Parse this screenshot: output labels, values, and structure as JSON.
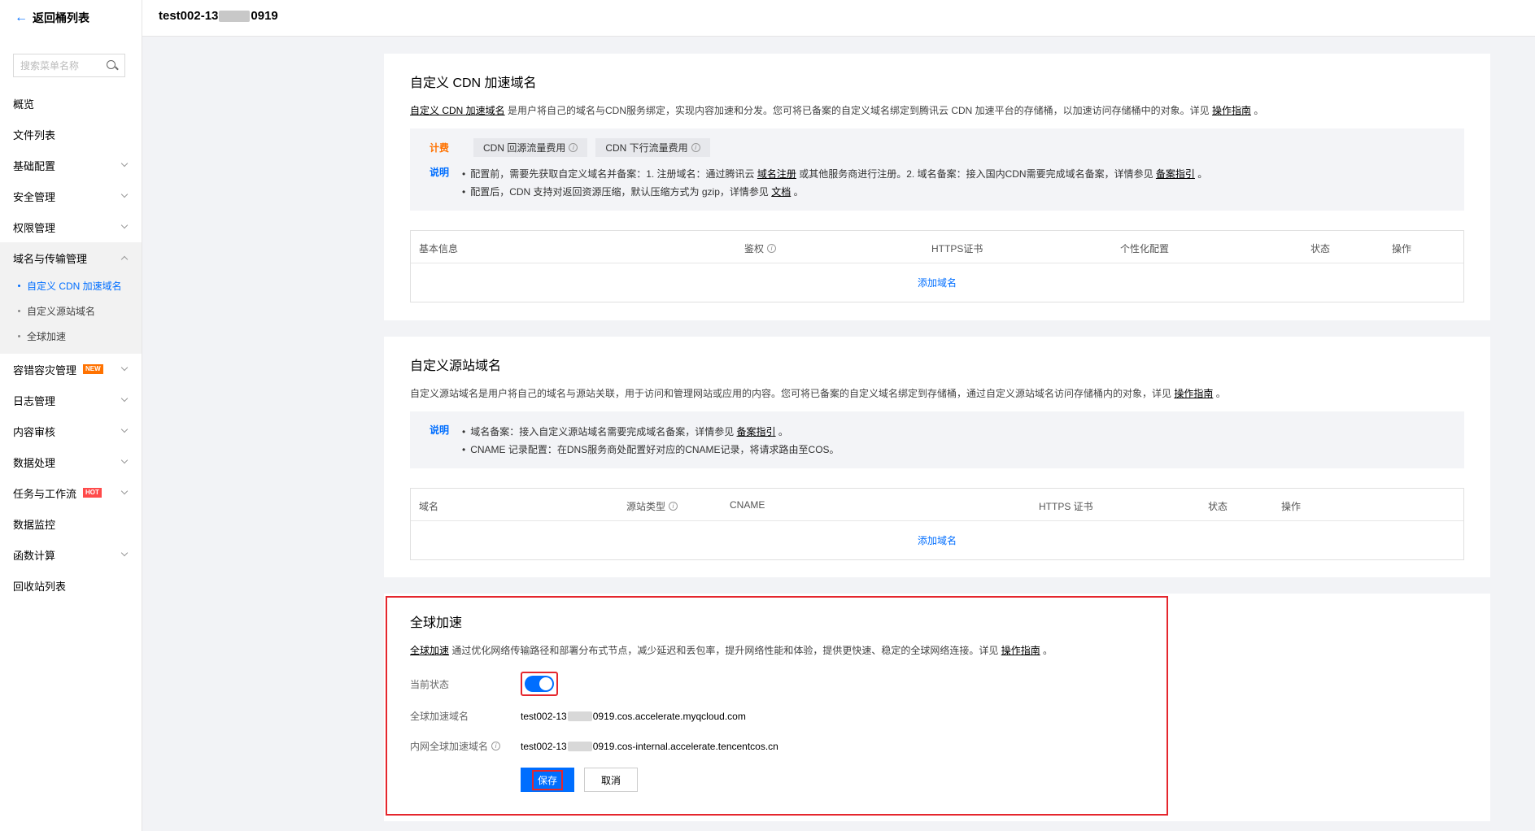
{
  "sidebar": {
    "back_label": "返回桶列表",
    "search_placeholder": "搜索菜单名称",
    "items": [
      {
        "label": "概览"
      },
      {
        "label": "文件列表"
      },
      {
        "label": "基础配置"
      },
      {
        "label": "安全管理"
      },
      {
        "label": "权限管理"
      },
      {
        "label": "域名与传输管理"
      },
      {
        "label": "容错容灾管理",
        "badge": "NEW"
      },
      {
        "label": "日志管理"
      },
      {
        "label": "内容审核"
      },
      {
        "label": "数据处理"
      },
      {
        "label": "任务与工作流",
        "badge": "HOT"
      },
      {
        "label": "数据监控"
      },
      {
        "label": "函数计算"
      },
      {
        "label": "回收站列表"
      }
    ],
    "sub_items": [
      "自定义 CDN 加速域名",
      "自定义源站域名",
      "全球加速"
    ]
  },
  "topbar": {
    "bucket_prefix": "test002-13",
    "bucket_suffix": "0919"
  },
  "cdn": {
    "title": "自定义 CDN 加速域名",
    "desc_link": "自定义 CDN 加速域名",
    "desc_text": " 是用户将自己的域名与CDN服务绑定，实现内容加速和分发。您可将已备案的自定义域名绑定到腾讯云 CDN 加速平台的存储桶，以加速访问存储桶中的对象。详见 ",
    "desc_guide": "操作指南",
    "desc_end": " 。",
    "fee_label": "计费",
    "fee_chip1": "CDN 回源流量费用",
    "fee_chip2": "CDN 下行流量费用",
    "note_label": "说明",
    "note1_a": "配置前，需要先获取自定义域名并备案：1. 注册域名：通过腾讯云 ",
    "note1_link1": "域名注册",
    "note1_b": " 或其他服务商进行注册。2. 域名备案：接入国内CDN需要完成域名备案，详情参见 ",
    "note1_link2": "备案指引",
    "note1_c": " 。",
    "note2_a": "配置后，CDN 支持对返回资源压缩，默认压缩方式为 gzip，详情参见 ",
    "note2_link": "文档",
    "note2_b": " 。",
    "columns": [
      "基本信息",
      "鉴权",
      "HTTPS证书",
      "个性化配置",
      "状态",
      "操作"
    ],
    "add_label": "添加域名"
  },
  "origin": {
    "title": "自定义源站域名",
    "desc_text": "自定义源站域名是用户将自己的域名与源站关联，用于访问和管理网站或应用的内容。您可将已备案的自定义域名绑定到存储桶，通过自定义源站域名访问存储桶内的对象，详见 ",
    "desc_guide": "操作指南",
    "desc_end": " 。",
    "note_label": "说明",
    "note1_a": "域名备案：接入自定义源站域名需要完成域名备案，详情参见 ",
    "note1_link": "备案指引",
    "note1_b": " 。",
    "note2": "CNAME 记录配置：在DNS服务商处配置好对应的CNAME记录，将请求路由至COS。",
    "columns": [
      "域名",
      "源站类型",
      "CNAME",
      "HTTPS 证书",
      "状态",
      "操作"
    ],
    "add_label": "添加域名"
  },
  "accel": {
    "title": "全球加速",
    "desc_link": "全球加速",
    "desc_text": " 通过优化网络传输路径和部署分布式节点，减少延迟和丢包率，提升网络性能和体验，提供更快速、稳定的全球网络连接。详见 ",
    "desc_guide": "操作指南",
    "desc_end": " 。",
    "status_label": "当前状态",
    "status_on": true,
    "domain_label": "全球加速域名",
    "domain_prefix": "test002-13",
    "domain_suffix": "0919.cos.accelerate.myqcloud.com",
    "internal_label": "内网全球加速域名",
    "internal_prefix": "test002-13",
    "internal_suffix": "0919.cos-internal.accelerate.tencentcos.cn",
    "save_label": "保存",
    "cancel_label": "取消"
  },
  "colors": {
    "accent": "#006eff",
    "highlight": "#e5262d",
    "fee": "#ff7200"
  }
}
